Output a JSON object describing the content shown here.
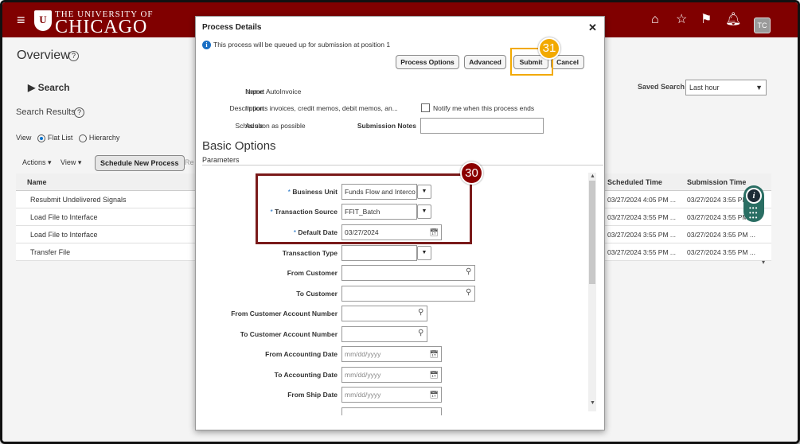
{
  "header": {
    "logo_top": "THE UNIVERSITY OF",
    "logo_main": "CHICAGO",
    "crest_letter": "U",
    "avatar": "TC",
    "icons": [
      "home-icon",
      "star-icon",
      "flag-icon",
      "bell-icon"
    ]
  },
  "page": {
    "title": "Overview",
    "help": "?",
    "search_heading": "Search",
    "search_results": "Search Results",
    "view_label": "View",
    "view_opt1": "Flat List",
    "view_opt2": "Hierarchy",
    "actions": "Actions ▾",
    "view_menu": "View ▾",
    "schedule_new": "Schedule New Process",
    "re_trunc": "Re",
    "saved_search_label": "Saved Search",
    "saved_search_value": "Last hour",
    "grid_header": "Name",
    "grid_rows": [
      "Resubmit Undelivered Signals",
      "Load File to Interface",
      "Load File to Interface",
      "Transfer File"
    ],
    "right_headers": [
      "Scheduled Time",
      "Submission Time"
    ],
    "right_rows": [
      [
        "03/27/2024 4:05 PM ...",
        "03/27/2024 3:55 PM ..."
      ],
      [
        "03/27/2024 3:55 PM ...",
        "03/27/2024 3:55 PM ..."
      ],
      [
        "03/27/2024 3:55 PM ...",
        "03/27/2024 3:55 PM ..."
      ],
      [
        "03/27/2024 3:55 PM ...",
        "03/27/2024 3:55 PM ..."
      ]
    ]
  },
  "dialog": {
    "title": "Process Details",
    "close": "✕",
    "info_msg": "This process will be queued up for submission at position 1",
    "buttons": {
      "process_options": "Process Options",
      "advanced": "Advanced",
      "submit": "Submit",
      "cancel": "Cancel"
    },
    "name_label": "Name",
    "name_value": "Import AutoInvoice",
    "description_label": "Description",
    "description_value": "Imports invoices, credit memos, debit memos, an...",
    "notify_label": "Notify me when this process ends",
    "schedule_label": "Schedule",
    "schedule_value": "As soon as possible",
    "submission_notes_label": "Submission Notes",
    "basic_options": "Basic Options",
    "parameters": "Parameters",
    "fields": [
      {
        "label": "Business Unit",
        "value": "Funds Flow and Interco",
        "required": true
      },
      {
        "label": "Transaction Source",
        "value": "FFIT_Batch",
        "required": true
      },
      {
        "label": "Default Date",
        "value": "03/27/2024",
        "required": true
      },
      {
        "label": "Transaction Type",
        "value": "",
        "required": false
      },
      {
        "label": "From Customer",
        "value": "",
        "required": false
      },
      {
        "label": "To Customer",
        "value": "",
        "required": false
      },
      {
        "label": "From Customer Account Number",
        "value": "",
        "required": false
      },
      {
        "label": "To Customer Account Number",
        "value": "",
        "required": false
      },
      {
        "label": "From Accounting Date",
        "value": "mm/dd/yyyy",
        "required": false
      },
      {
        "label": "To Accounting Date",
        "value": "mm/dd/yyyy",
        "required": false
      },
      {
        "label": "From Ship Date",
        "value": "mm/dd/yyyy",
        "required": false
      }
    ]
  },
  "callouts": {
    "step_30": "30",
    "step_31": "31"
  },
  "colors": {
    "header_bg": "#800000",
    "callout_red": "#8b0000",
    "callout_orange": "#f2a900",
    "accent": "#1a6fc4"
  }
}
